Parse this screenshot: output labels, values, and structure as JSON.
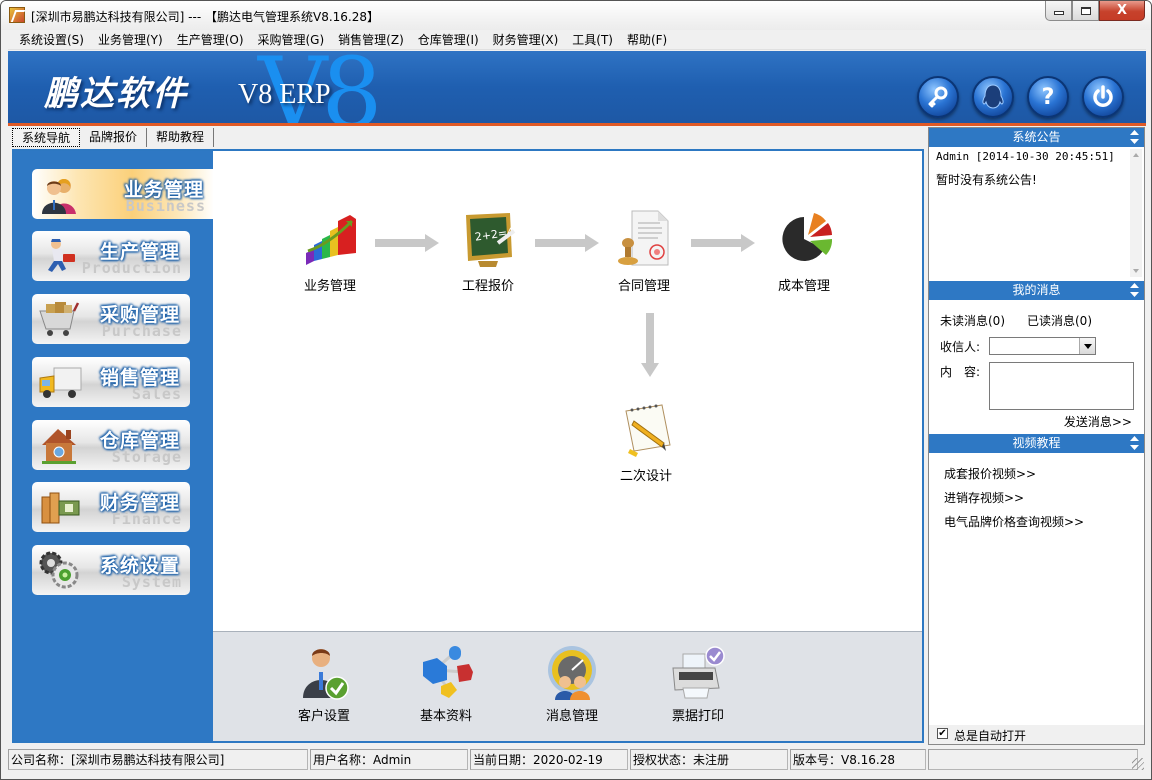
{
  "window": {
    "title": "[深圳市易鹏达科技有限公司] --- 【鹏达电气管理系统V8.16.28】",
    "controls": {
      "minimize": "minimize",
      "maximize": "maximize",
      "close": "X"
    }
  },
  "menubar": {
    "items": [
      "系统设置(S)",
      "业务管理(Y)",
      "生产管理(O)",
      "采购管理(G)",
      "销售管理(Z)",
      "仓库管理(I)",
      "财务管理(X)",
      "工具(T)",
      "帮助(F)"
    ]
  },
  "banner": {
    "logo": "鹏达软件",
    "product": "V8 ERP",
    "watermark": "V8",
    "icons": [
      "key-icon",
      "qq-penguin-icon",
      "help-icon",
      "power-icon"
    ]
  },
  "tabs": {
    "items": [
      "系统导航",
      "品牌报价",
      "帮助教程"
    ],
    "active": "系统导航"
  },
  "nav": {
    "items": [
      {
        "label": "业务管理",
        "sub": "Business",
        "active": true
      },
      {
        "label": "生产管理",
        "sub": "Production",
        "active": false
      },
      {
        "label": "采购管理",
        "sub": "Purchase",
        "active": false
      },
      {
        "label": "销售管理",
        "sub": "Sales",
        "active": false
      },
      {
        "label": "仓库管理",
        "sub": "Storage",
        "active": false
      },
      {
        "label": "财务管理",
        "sub": "Finance",
        "active": false
      },
      {
        "label": "系统设置",
        "sub": "System",
        "active": false
      }
    ]
  },
  "flow": {
    "nodes": [
      "业务管理",
      "工程报价",
      "合同管理",
      "成本管理",
      "二次设计"
    ]
  },
  "tools": {
    "items": [
      "客户设置",
      "基本资料",
      "消息管理",
      "票据打印"
    ]
  },
  "right_panel": {
    "notice": {
      "title": "系统公告",
      "meta": "Admin [2014-10-30 20:45:51]",
      "text": "暂时没有系统公告!"
    },
    "messages": {
      "title": "我的消息",
      "unread": "未读消息(0)",
      "read": "已读消息(0)",
      "recipient_label": "收信人:",
      "recipient_value": "",
      "content_label": "内　容:",
      "content_value": "",
      "send": "发送消息>>"
    },
    "videos": {
      "title": "视频教程",
      "links": [
        "成套报价视频>>",
        "进销存视频>>",
        "电气品牌价格查询视频>>"
      ]
    },
    "auto_open": {
      "label": "总是自动打开",
      "checked": true,
      "check_glyph": "✔"
    }
  },
  "statusbar": {
    "company": "公司名称：[深圳市易鹏达科技有限公司]",
    "user": "用户名称：Admin",
    "date": "当前日期：2020-02-19",
    "license": "授权状态：未注册",
    "version": "版本号：V8.16.28",
    "extra": ""
  },
  "colors": {
    "accent_blue": "#2e78c4",
    "banner_strip": "#e05a26",
    "close_red": "#c7422c"
  }
}
